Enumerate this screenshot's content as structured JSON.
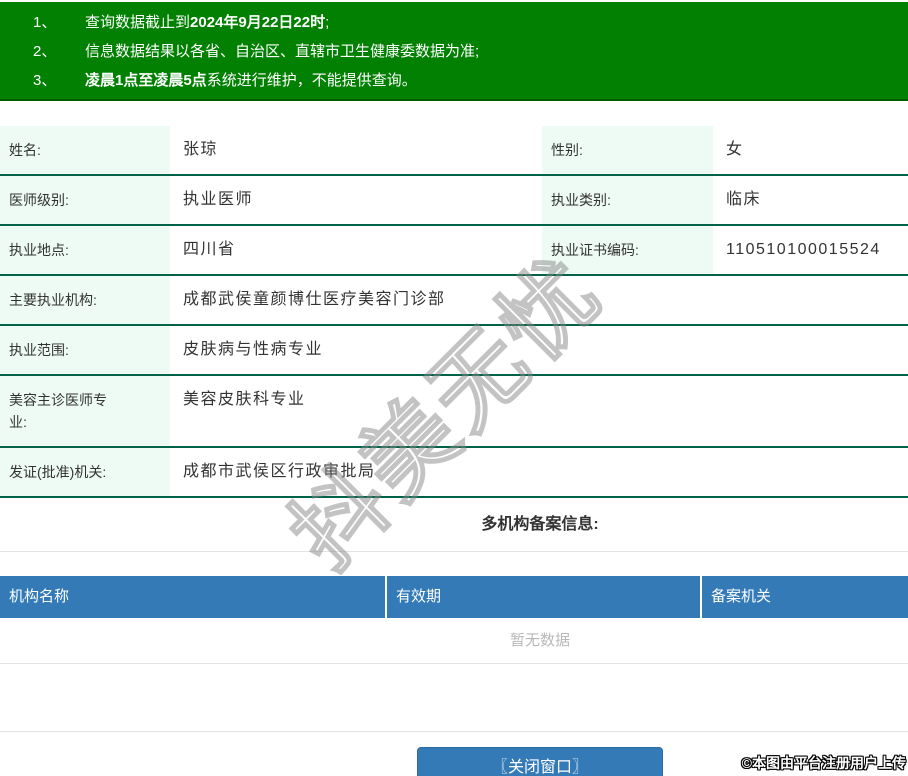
{
  "notice": {
    "items": [
      {
        "num": "1、",
        "pre": "查询数据截止到",
        "bold": "2024年9月22日22时",
        "post": ";"
      },
      {
        "num": "2、",
        "pre": "信息数据结果以各省、自治区、直辖市卫生健康委数据为准;",
        "bold": "",
        "post": ""
      },
      {
        "num": "3、",
        "pre": "",
        "bold": "凌晨1点至凌晨5点",
        "post": "系统进行维护，不能提供查询。"
      }
    ]
  },
  "detail": {
    "rows": [
      {
        "cells": [
          {
            "label": "姓名:",
            "value": "张琼"
          },
          {
            "label": "性别:",
            "value": "女"
          }
        ]
      },
      {
        "cells": [
          {
            "label": "医师级别:",
            "value": "执业医师"
          },
          {
            "label": "执业类别:",
            "value": "临床"
          }
        ]
      },
      {
        "cells": [
          {
            "label": "执业地点:",
            "value": "四川省"
          },
          {
            "label": "执业证书编码:",
            "value": "110510100015524"
          }
        ]
      },
      {
        "cells": [
          {
            "label": "主要执业机构:",
            "value": "成都武侯童颜博仕医疗美容门诊部"
          }
        ]
      },
      {
        "cells": [
          {
            "label": "执业范围:",
            "value": "皮肤病与性病专业"
          }
        ]
      },
      {
        "cells": [
          {
            "label": "美容主诊医师专业:",
            "value": "美容皮肤科专业"
          }
        ]
      },
      {
        "cells": [
          {
            "label": "发证(批准)机关:",
            "value": "成都市武侯区行政审批局"
          }
        ]
      }
    ]
  },
  "filing": {
    "title": "多机构备案信息:",
    "headers": [
      "机构名称",
      "有效期",
      "备案机关"
    ],
    "empty_text": "暂无数据"
  },
  "actions": {
    "close_label": "〖关闭窗口〗"
  },
  "watermarks": {
    "center": "抖美无忧",
    "footer": "©本图由平台注册用户上传"
  },
  "colors": {
    "banner_green": "#018001",
    "row_border_green": "#006247",
    "label_bg_mint": "#edfbf4",
    "table_header_blue": "#337ab7",
    "button_blue": "#337ab7",
    "empty_text_gray": "#b8b8b8"
  }
}
